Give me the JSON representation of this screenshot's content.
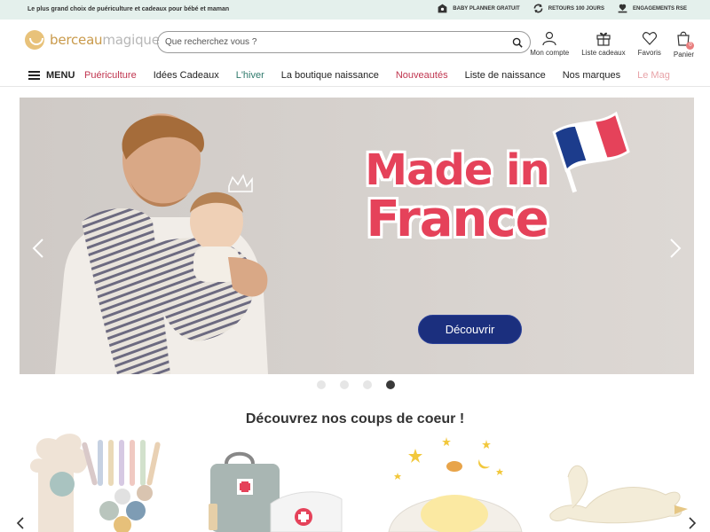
{
  "topbar": {
    "tagline": "Le plus grand choix de puériculture et cadeaux pour bébé et maman",
    "perks": [
      {
        "icon": "baby-planner-icon",
        "label": "BABY PLANNER GRATUIT"
      },
      {
        "icon": "returns-icon",
        "label": "RETOURS 100 JOURS"
      },
      {
        "icon": "rse-icon",
        "label": "ENGAGEMENTS RSE"
      }
    ]
  },
  "header": {
    "logo_part1": "berceau",
    "logo_part2": "magique",
    "search_placeholder": "Que recherchez vous ?",
    "actions": [
      {
        "icon": "user-icon",
        "label": "Mon compte"
      },
      {
        "icon": "gift-icon",
        "label": "Liste cadeaux"
      },
      {
        "icon": "heart-icon",
        "label": "Favoris"
      },
      {
        "icon": "cart-icon",
        "label": "Panier"
      }
    ],
    "cart_count": "0"
  },
  "nav": {
    "menu_label": "MENU",
    "items": [
      {
        "label": "Puériculture",
        "color": "#c0354f"
      },
      {
        "label": "Idées Cadeaux",
        "color": "#222222"
      },
      {
        "label": "L'hiver",
        "color": "#2f7a6c"
      },
      {
        "label": "La boutique naissance",
        "color": "#222222"
      },
      {
        "label": "Nouveautés",
        "color": "#c0354f"
      },
      {
        "label": "Liste de naissance",
        "color": "#222222"
      },
      {
        "label": "Nos marques",
        "color": "#222222"
      },
      {
        "label": "Le Mag",
        "color": "#e8a3a8"
      }
    ]
  },
  "hero": {
    "headline_line1": "Made in",
    "headline_line2": "France",
    "cta_label": "Découvrir",
    "slides_total": 4,
    "active_slide": 4
  },
  "section": {
    "title": "Découvrez nos coups de coeur !"
  },
  "colors": {
    "accent_red": "#e5425a",
    "cta_blue": "#1b2f7e",
    "topbar_bg": "#e4f0ec",
    "logo_gold": "#c99a4b"
  }
}
